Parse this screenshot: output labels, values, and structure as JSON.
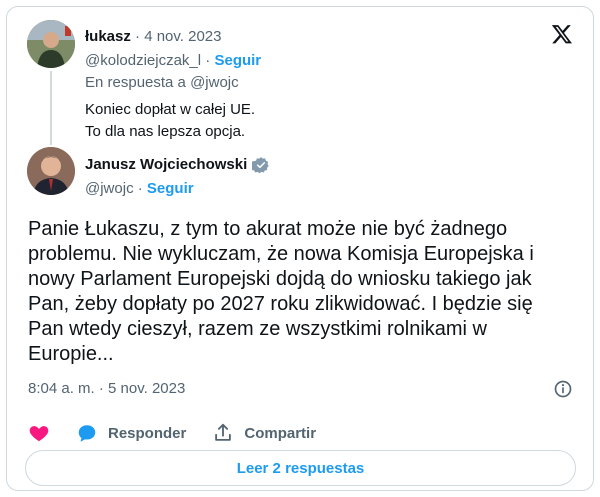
{
  "reply_tweet": {
    "name": "łukasz",
    "date": "4 nov. 2023",
    "handle": "@kolodziejczak_l",
    "follow_label": "Seguir",
    "replying_to": "En respuesta a @jwojc",
    "text_line1": "Koniec dopłat w całej UE.",
    "text_line2": "To dla nas lepsza opcja."
  },
  "main_tweet": {
    "name": "Janusz Wojciechowski",
    "handle": "@jwojc",
    "follow_label": "Seguir",
    "lines": [
      "Panie Łukaszu, z tym to akurat może nie być żadnego",
      "problemu. Nie wykluczam, że nowa Komisja Europejska i",
      "nowy Parlament Europejski dojdą do wniosku takiego jak",
      "Pan, żeby dopłaty po 2027 roku zlikwidować. I będzie się",
      "Pan wtedy cieszył, razem ze wszystkimi rolnikami w",
      "Europie..."
    ],
    "timestamp": "8:04 a. m. · 5 nov. 2023"
  },
  "actions": {
    "reply_label": "Responder",
    "share_label": "Compartir"
  },
  "read_replies_label": "Leer 2 respuestas",
  "colors": {
    "accent": "#1d9bf0",
    "like": "#f91880",
    "text": "#0f1419",
    "muted": "#536471",
    "border": "#cfd9de"
  },
  "icons": [
    "x-logo-icon",
    "verified-badge-icon",
    "info-icon",
    "heart-icon",
    "reply-bubble-icon",
    "share-icon"
  ]
}
